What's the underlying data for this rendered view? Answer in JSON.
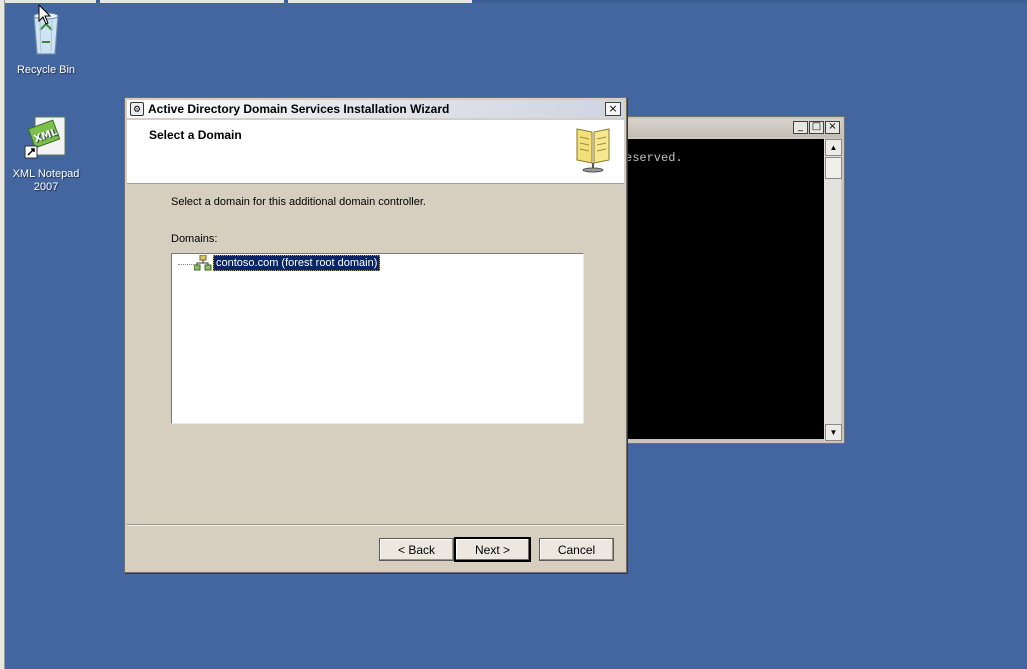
{
  "desktop": {
    "icons": [
      {
        "label": "Recycle Bin"
      },
      {
        "label": "XML Notepad 2007"
      }
    ]
  },
  "console": {
    "output_text": "eserved."
  },
  "wizard": {
    "title": "Active Directory Domain Services Installation Wizard",
    "header": "Select a Domain",
    "instruction": "Select a domain for this additional domain controller.",
    "domains_label": "Domains:",
    "domains": [
      {
        "name": "contoso.com (forest root domain)",
        "selected": true
      }
    ],
    "buttons": {
      "back": "< Back",
      "next": "Next >",
      "cancel": "Cancel"
    }
  },
  "colors": {
    "desktop": "#4466a0",
    "selection": "#0a246a",
    "dialog": "#d6cfc0"
  }
}
